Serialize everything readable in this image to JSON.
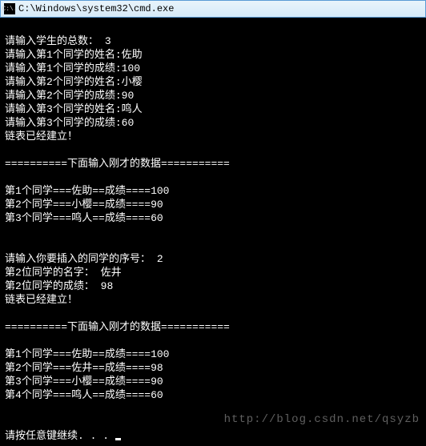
{
  "window": {
    "title": "C:\\Windows\\system32\\cmd.exe",
    "icon_label": "C:\\."
  },
  "prompts": {
    "total": "请输入学生的总数：",
    "total_value": "3",
    "name_prefix": "请输入第",
    "name_suffix": "个同学的姓名:",
    "score_prefix": "请输入第",
    "score_suffix": "个同学的成绩:",
    "list_built": "链表已经建立！",
    "divider_prefix": "==========",
    "divider_label": "下面输入刚才的数据",
    "divider_suffix": "===========",
    "row_prefix": "第",
    "row_mid": "个同学===",
    "row_score": "==成绩====",
    "insert_seq": "请输入你要插入的同学的序号：",
    "insert_seq_value": "2",
    "insert_name_prefix": "第",
    "insert_name_suffix": "位同学的名字：",
    "insert_score_prefix": "第",
    "insert_score_suffix": "位同学的成绩：",
    "press_any": "请按任意键继续. . ."
  },
  "students_input": [
    {
      "idx": "1",
      "name": "佐助",
      "score": "100"
    },
    {
      "idx": "2",
      "name": "小樱",
      "score": "90"
    },
    {
      "idx": "3",
      "name": "鸣人",
      "score": "60"
    }
  ],
  "list1": [
    {
      "idx": "1",
      "name": "佐助",
      "score": "100"
    },
    {
      "idx": "2",
      "name": "小樱",
      "score": "90"
    },
    {
      "idx": "3",
      "name": "鸣人",
      "score": "60"
    }
  ],
  "inserted": {
    "idx": "2",
    "name": "佐井",
    "score": "98"
  },
  "list2": [
    {
      "idx": "1",
      "name": "佐助",
      "score": "100"
    },
    {
      "idx": "2",
      "name": "佐井",
      "score": "98"
    },
    {
      "idx": "3",
      "name": "小樱",
      "score": "90"
    },
    {
      "idx": "4",
      "name": "鸣人",
      "score": "60"
    }
  ],
  "watermark": "http://blog.csdn.net/qsyzb"
}
